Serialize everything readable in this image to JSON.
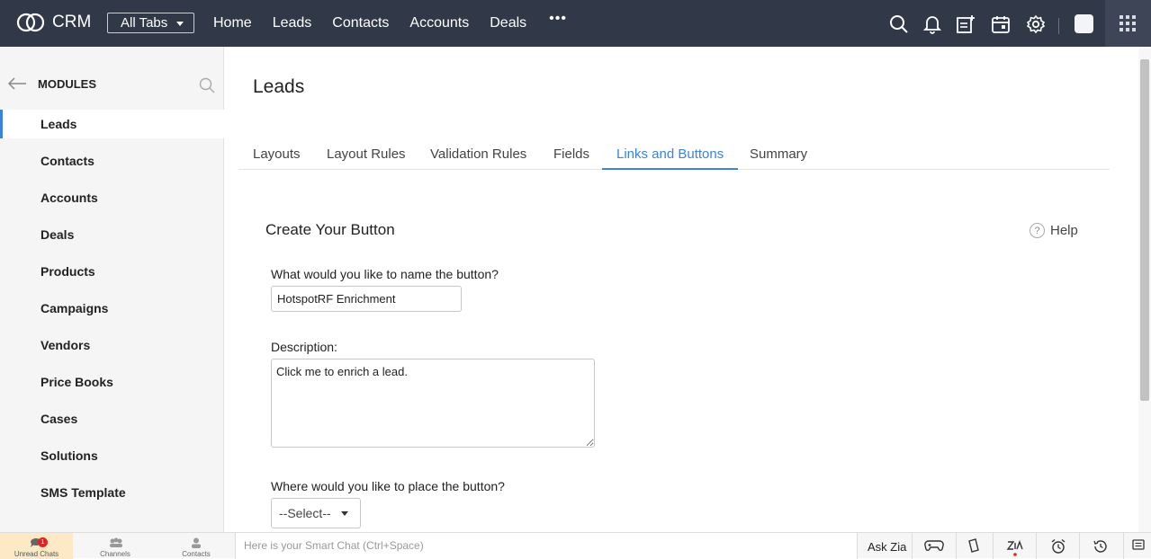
{
  "topbar": {
    "logo_text": "CRM",
    "all_tabs": "All Tabs",
    "nav": [
      "Home",
      "Leads",
      "Contacts",
      "Accounts",
      "Deals"
    ],
    "more": "•••"
  },
  "sidebar": {
    "title": "MODULES",
    "items": [
      "Leads",
      "Contacts",
      "Accounts",
      "Deals",
      "Products",
      "Campaigns",
      "Vendors",
      "Price Books",
      "Cases",
      "Solutions",
      "SMS Template"
    ],
    "active_index": 0
  },
  "main": {
    "title": "Leads",
    "tabs": [
      "Layouts",
      "Layout Rules",
      "Validation Rules",
      "Fields",
      "Links and Buttons",
      "Summary"
    ],
    "active_tab": "Links and Buttons",
    "section_title": "Create Your Button",
    "help_label": "Help",
    "help_icon": "?",
    "name_label": "What would you like to name the button?",
    "name_value": "HotspotRF Enrichment",
    "description_label": "Description:",
    "description_value": "Click me to enrich a lead.",
    "placement_label": "Where would you like to place the button?",
    "placement_value": "--Select--"
  },
  "bottombar": {
    "unread_chats": "Unread Chats",
    "unread_count": "1",
    "channels": "Channels",
    "contacts": "Contacts",
    "smart_chat_placeholder": "Here is your Smart Chat (Ctrl+Space)",
    "ask_zia": "Ask Zia"
  },
  "colors": {
    "topbar": "#313949",
    "accent": "#3b83df",
    "badge": "#e02424"
  }
}
